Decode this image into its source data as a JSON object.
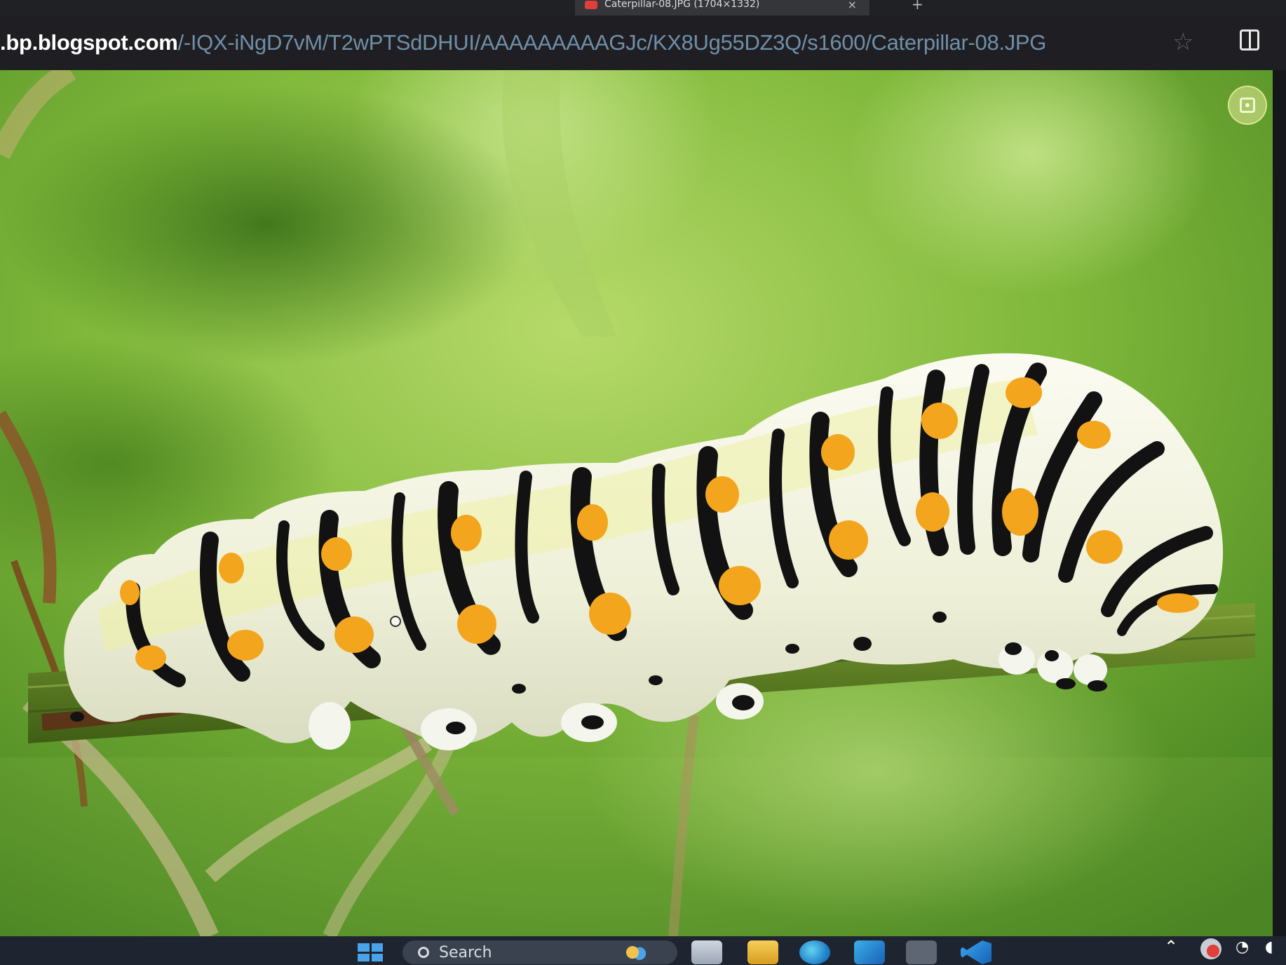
{
  "browser": {
    "tab": {
      "title": "Caterpillar-08.JPG (1704×1332)",
      "close_glyph": "×"
    },
    "new_tab_glyph": "+",
    "url_host": ".bp.blogspot.com",
    "url_path": "/-IQX-iNgD7vM/T2wPTSdDHUI/AAAAAAAAAGJc/KX8Ug55DZ3Q/s1600/Caterpillar-08.JPG",
    "icons": [
      "favicon-icon",
      "star-icon",
      "split-screen-icon",
      "visual-search-icon"
    ]
  },
  "image": {
    "subject": "caterpillar",
    "colors": {
      "background_light": "#a8d25a",
      "background_mid": "#6aa52b",
      "background_dark": "#3f7c1d",
      "body_white": "#f3f4ea",
      "stripe_black": "#141414",
      "spot_orange": "#f3a51d",
      "stem": "#5d7f23"
    }
  },
  "taskbar": {
    "search_label": "Search",
    "icons": [
      "start-icon",
      "search-icon",
      "widgets-icon",
      "task-view-icon",
      "file-explorer-icon",
      "edge-icon",
      "store-icon",
      "app-icon",
      "vscode-icon",
      "chevron-up-icon",
      "battery-icon",
      "wifi-icon",
      "volume-icon"
    ]
  }
}
